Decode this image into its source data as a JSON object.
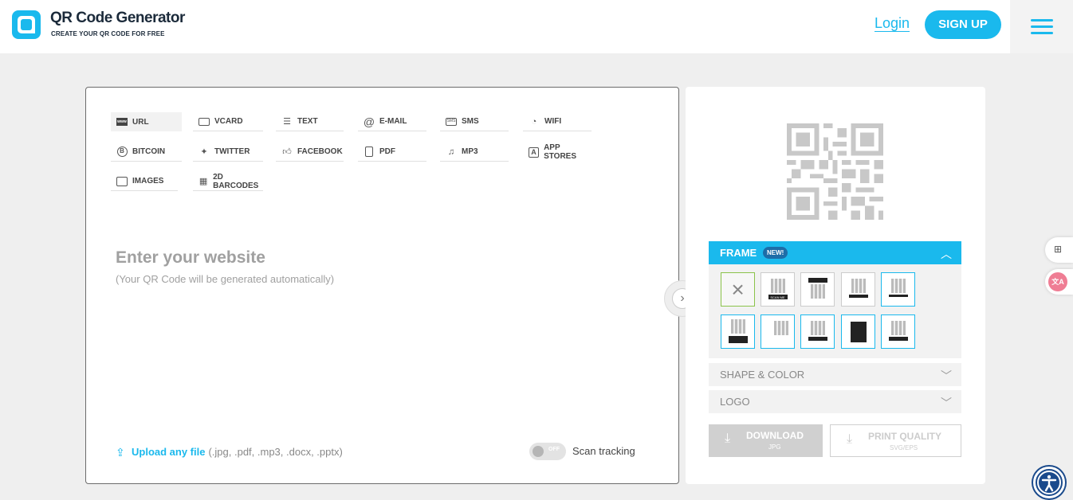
{
  "header": {
    "brand": "QR Code Generator",
    "tagline": "CREATE YOUR QR CODE FOR FREE",
    "login": "Login",
    "signup": "SIGN UP"
  },
  "tabs": [
    {
      "label": "URL",
      "icon": "www-icon"
    },
    {
      "label": "VCARD",
      "icon": "vcard-icon"
    },
    {
      "label": "TEXT",
      "icon": "text-icon"
    },
    {
      "label": "E-MAIL",
      "icon": "at-icon"
    },
    {
      "label": "SMS",
      "icon": "sms-icon"
    },
    {
      "label": "WIFI",
      "icon": "wifi-icon"
    },
    {
      "label": "BITCOIN",
      "icon": "bitcoin-icon"
    },
    {
      "label": "TWITTER",
      "icon": "twitter-icon"
    },
    {
      "label": "FACEBOOK",
      "icon": "thumbs-up-icon"
    },
    {
      "label": "PDF",
      "icon": "pdf-icon"
    },
    {
      "label": "MP3",
      "icon": "music-note-icon"
    },
    {
      "label": "APP STORES",
      "icon": "app-store-icon"
    },
    {
      "label": "IMAGES",
      "icon": "image-icon"
    },
    {
      "label": "2D BARCODES",
      "icon": "barcode-icon"
    }
  ],
  "main": {
    "title": "Enter your website",
    "subtitle": "(Your QR Code will be generated automatically)",
    "upload_link": "Upload any file",
    "upload_types": "(.jpg, .pdf, .mp3, .docx, .pptx)",
    "toggle_state": "OFF",
    "scan_tracking": "Scan tracking"
  },
  "panel": {
    "frame_label": "FRAME",
    "frame_badge": "NEW!",
    "shape_color": "SHAPE & COLOR",
    "logo": "LOGO",
    "download_title": "DOWNLOAD",
    "download_sub": "JPG",
    "print_title": "PRINT QUALITY",
    "print_sub": "SVG/EPS",
    "frame_caption": "SCAN ME"
  },
  "colors": {
    "accent": "#1ab9ed",
    "badge": "#1d6da8",
    "selected_frame": "#8bc34a"
  }
}
